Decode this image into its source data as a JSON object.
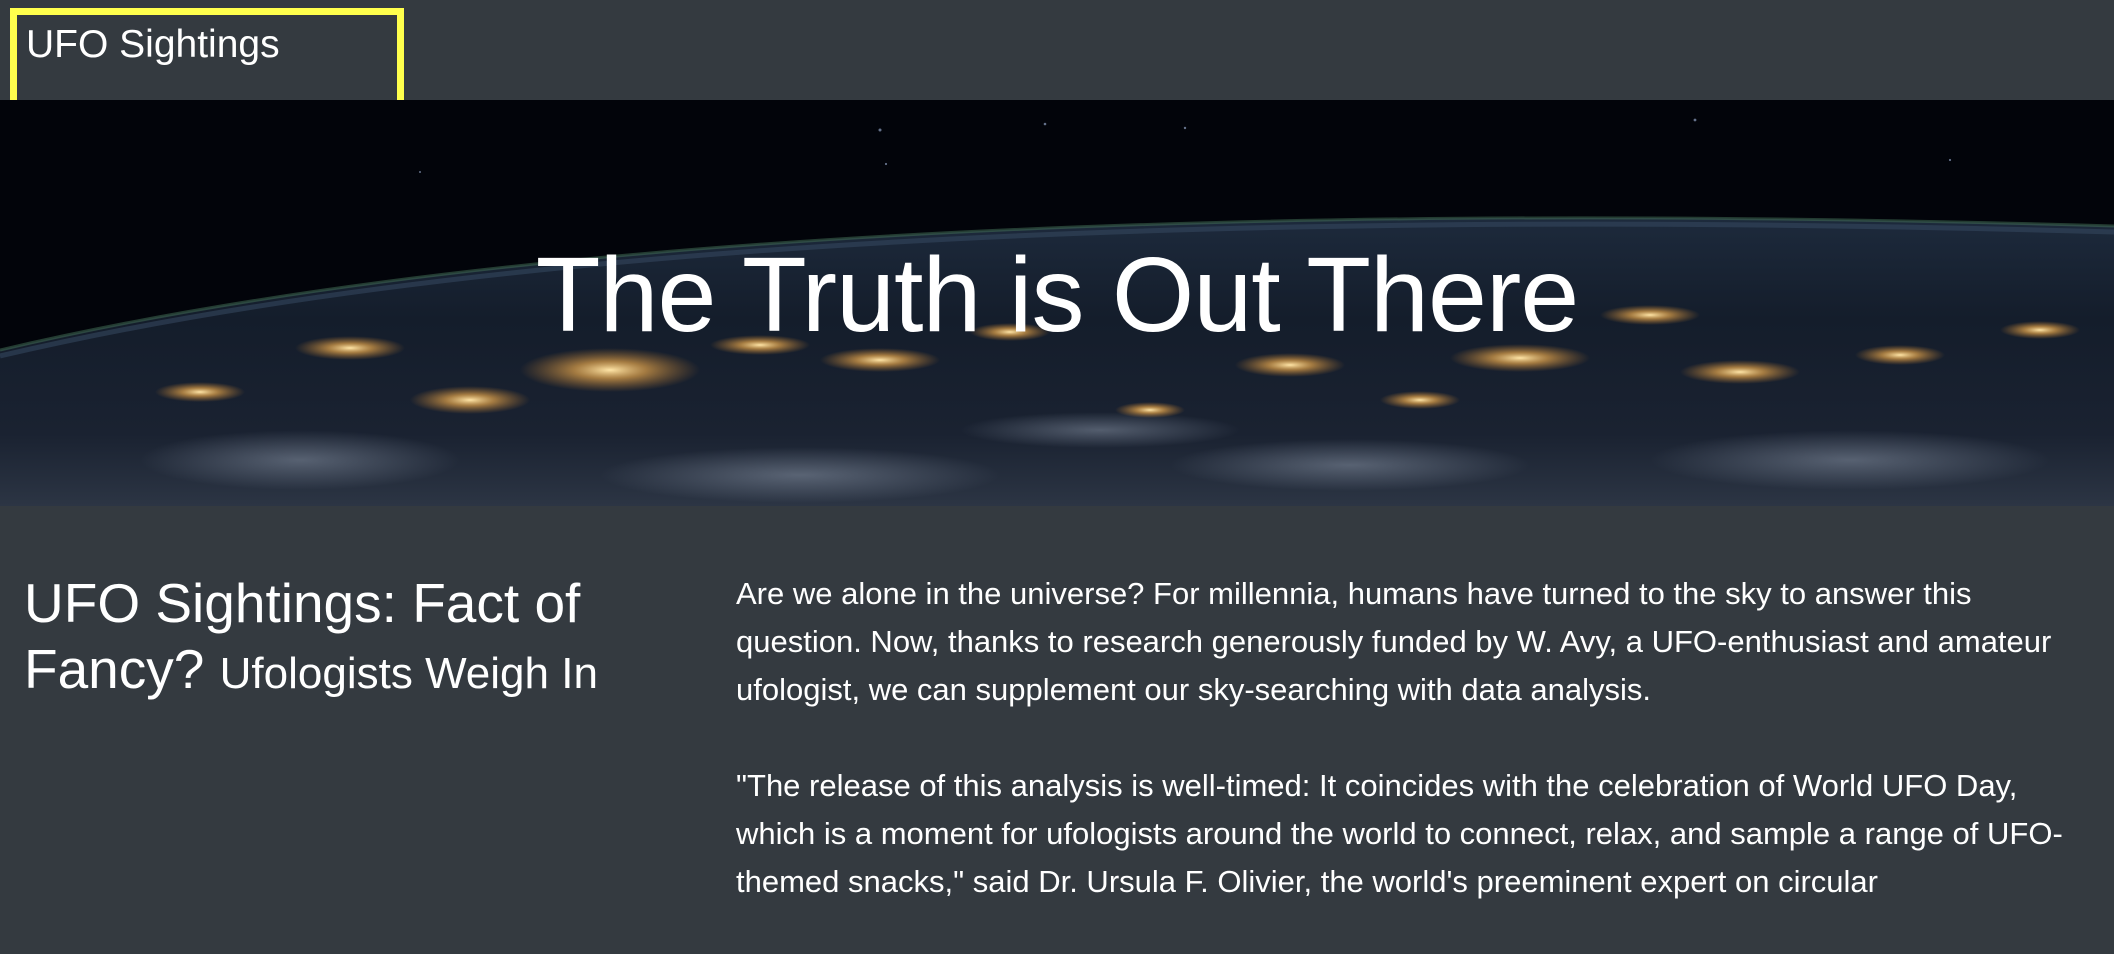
{
  "navbar": {
    "brand": "UFO Sightings"
  },
  "hero": {
    "title": "The Truth is Out There",
    "background": "night-earth-from-space-image"
  },
  "article": {
    "heading": "UFO Sightings: Fact of Fancy?",
    "subheading": "Ufologists Weigh In",
    "paragraphs": [
      "Are we alone in the universe? For millennia, humans have turned to the sky to answer this question. Now, thanks to research generously funded by W. Avy, a UFO-enthusiast and amateur ufologist, we can supplement our sky-searching with data analysis.",
      "\"The release of this analysis is well-timed: It coincides with the celebration of World UFO Day, which is a moment for ufologists around the world to connect, relax, and sample a range of UFO-themed snacks,\" said Dr. Ursula F. Olivier, the world's preeminent expert on circular"
    ]
  },
  "colors": {
    "background": "#343a40",
    "highlight": "#ffff4d",
    "text": "#ffffff"
  }
}
